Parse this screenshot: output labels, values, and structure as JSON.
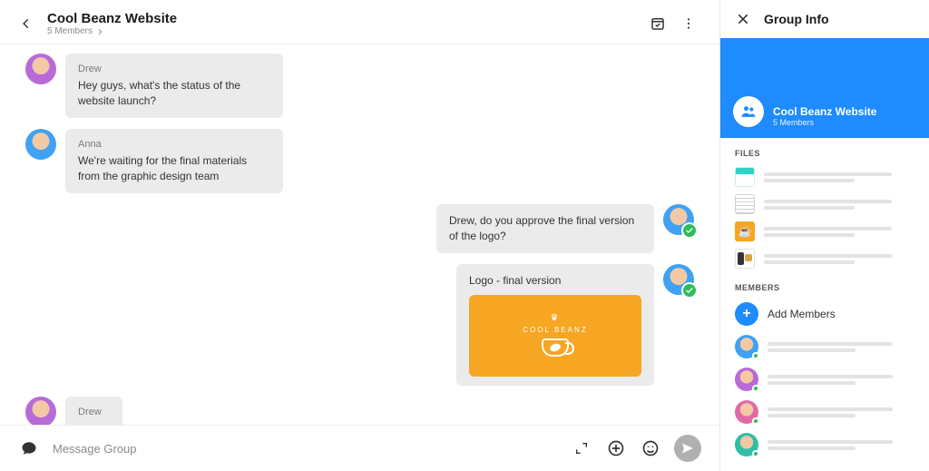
{
  "chat": {
    "title": "Cool Beanz Website",
    "subtitle": "5 Members",
    "input_placeholder": "Message Group",
    "messages": [
      {
        "from": "Drew",
        "side": "left",
        "avatar": "purple",
        "text": "Hey guys, what's the status of the website launch?"
      },
      {
        "from": "Anna",
        "side": "left",
        "avatar": "blue",
        "text": "We're waiting for the final materials from the graphic design team"
      },
      {
        "from": "Me",
        "side": "right",
        "avatar": "blue",
        "text": "Drew, do you approve the final version of the logo?",
        "status": "sent"
      },
      {
        "from": "Me",
        "side": "right",
        "avatar": "blue",
        "text": "Logo - final version",
        "attachment": "logo",
        "status": "sent"
      },
      {
        "from": "Drew",
        "side": "left",
        "avatar": "purple",
        "typing": true
      }
    ],
    "logo_text": "COOL BEANZ"
  },
  "info": {
    "panel_title": "Group Info",
    "group_name": "Cool Beanz Website",
    "group_sub": "5 Members",
    "files_label": "FILES",
    "members_label": "MEMBERS",
    "add_members": "Add Members",
    "files": [
      {
        "thumb": "teal"
      },
      {
        "thumb": "doc"
      },
      {
        "thumb": "logo"
      },
      {
        "thumb": "photo"
      }
    ],
    "members": [
      {
        "avatar": "blue",
        "online": true
      },
      {
        "avatar": "purple",
        "online": true
      },
      {
        "avatar": "pink",
        "online": true
      },
      {
        "avatar": "teal",
        "online": true
      }
    ]
  }
}
